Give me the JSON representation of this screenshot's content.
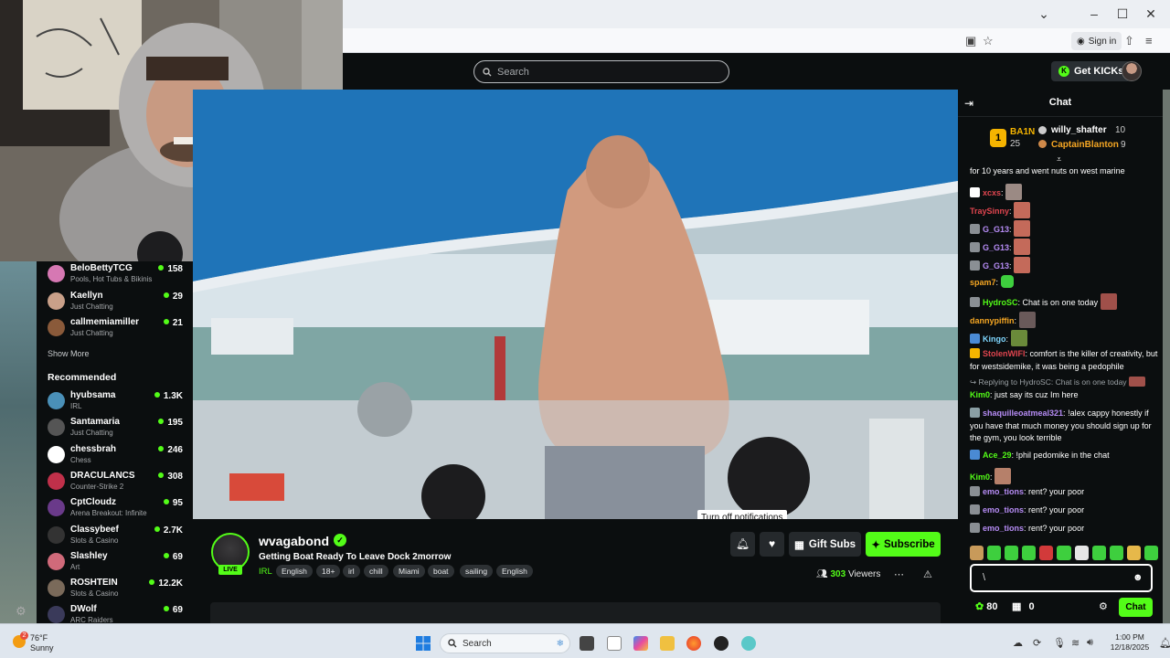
{
  "browser": {
    "sign_in": "Sign in",
    "window_controls": [
      "minimize",
      "maximize",
      "close"
    ]
  },
  "header": {
    "search_placeholder": "Search",
    "get_kicks": "Get KICKs"
  },
  "sidebar": {
    "following": [
      {
        "name": "BeloBettyTCG",
        "category": "Pools, Hot Tubs & Bikinis",
        "viewers": "158",
        "avatar_color": "#d678b3"
      },
      {
        "name": "Kaellyn",
        "category": "Just Chatting",
        "viewers": "29",
        "avatar_color": "#c9a089"
      },
      {
        "name": "callmemiamiller",
        "category": "Just Chatting",
        "viewers": "21",
        "avatar_color": "#8a5a3a"
      }
    ],
    "show_more": "Show More",
    "recommended_title": "Recommended",
    "recommended": [
      {
        "name": "hyubsama",
        "category": "IRL",
        "viewers": "1.3K",
        "avatar_color": "#4a90b8"
      },
      {
        "name": "Santamaria",
        "category": "Just Chatting",
        "viewers": "195",
        "avatar_color": "#555555"
      },
      {
        "name": "chessbrah",
        "category": "Chess",
        "viewers": "246",
        "avatar_color": "#ffffff"
      },
      {
        "name": "DRACULANCS",
        "category": "Counter-Strike 2",
        "viewers": "308",
        "avatar_color": "#c0304a"
      },
      {
        "name": "CptCloudz",
        "category": "Arena Breakout: Infinite",
        "viewers": "95",
        "avatar_color": "#6a3a8a"
      },
      {
        "name": "Classybeef",
        "category": "Slots & Casino",
        "viewers": "2.7K",
        "avatar_color": "#333333"
      },
      {
        "name": "Slashley",
        "category": "Art",
        "viewers": "69",
        "avatar_color": "#d06a7a"
      },
      {
        "name": "ROSHTEIN",
        "category": "Slots & Casino",
        "viewers": "12.2K",
        "avatar_color": "#7a6a5a"
      },
      {
        "name": "DWolf",
        "category": "ARC Raiders",
        "viewers": "69",
        "avatar_color": "#3a3a5a"
      }
    ]
  },
  "channel": {
    "name": "wvagabond",
    "live": "LIVE",
    "title": "Getting Boat Ready To Leave Dock 2morrow",
    "category": "IRL",
    "tags": [
      "English",
      "18+",
      "irl",
      "chill",
      "Miami",
      "boat",
      "sailing",
      "English"
    ],
    "viewers_count": "303",
    "viewers_label": "Viewers",
    "gift_subs": "Gift Subs",
    "subscribe": "Subscribe",
    "tooltip": "Turn off notifications"
  },
  "chat": {
    "title": "Chat",
    "leaderboard": {
      "first": {
        "name": "BA1N",
        "value": "25"
      },
      "second": {
        "name": "willy_shafter",
        "value": "10"
      },
      "third": {
        "name": "CaptainBlanton",
        "value": "9"
      }
    },
    "messages": [
      {
        "user": "",
        "text": "for 10 years and went nuts on west marine",
        "color": "#ffffff"
      },
      {
        "user": "xcxs",
        "text": "",
        "color": "#e0454f"
      },
      {
        "user": "TraySinny",
        "text": "",
        "color": "#e0454f"
      },
      {
        "user": "G_G13",
        "text": "",
        "color": "#b68cf5"
      },
      {
        "user": "G_G13",
        "text": "",
        "color": "#b68cf5"
      },
      {
        "user": "G_G13",
        "text": "",
        "color": "#b68cf5"
      },
      {
        "user": "spam7",
        "text": "",
        "color": "#f5a623"
      },
      {
        "user": "HydroSC",
        "text": "Chat is on one today",
        "color": "#53fc18"
      },
      {
        "user": "dannypiffin",
        "text": "",
        "color": "#f5a623"
      },
      {
        "user": "Kingo",
        "text": "",
        "color": "#7fd7ff"
      },
      {
        "user": "StolenWIFI",
        "text": "comfort is the killer of creativity, but for westsidemike, it was being a pedophile",
        "color": "#e0454f"
      },
      {
        "user": "",
        "text": "Replying to HydroSC: Chat is on one today",
        "color": "#9aa0a4"
      },
      {
        "user": "Kim0",
        "text": "just say its cuz Im here",
        "color": "#53fc18"
      },
      {
        "user": "shaquilleoatmeal321",
        "text": "!alex cappy honestly if you have that much money you should sign up for the gym, you look terrible",
        "color": "#b68cf5"
      },
      {
        "user": "Ace_29",
        "text": "!phil pedomike in the chat",
        "color": "#53fc18"
      },
      {
        "user": "Kim0",
        "text": "",
        "color": "#53fc18"
      },
      {
        "user": "emo_tions",
        "text": "rent? your poor",
        "color": "#b68cf5"
      },
      {
        "user": "emo_tions",
        "text": "rent? your poor",
        "color": "#b68cf5"
      },
      {
        "user": "emo_tions",
        "text": "rent? your poor",
        "color": "#b68cf5"
      }
    ],
    "input_value": "\\",
    "kick_points": "80",
    "gift_count": "0",
    "send": "Chat"
  },
  "taskbar": {
    "temp": "76°F",
    "weather": "Sunny",
    "weather_badge": "2",
    "search": "Search",
    "time": "1:00 PM",
    "date": "12/18/2025"
  },
  "colors": {
    "kick_green": "#53fc18",
    "background": "#0b0e0f"
  }
}
